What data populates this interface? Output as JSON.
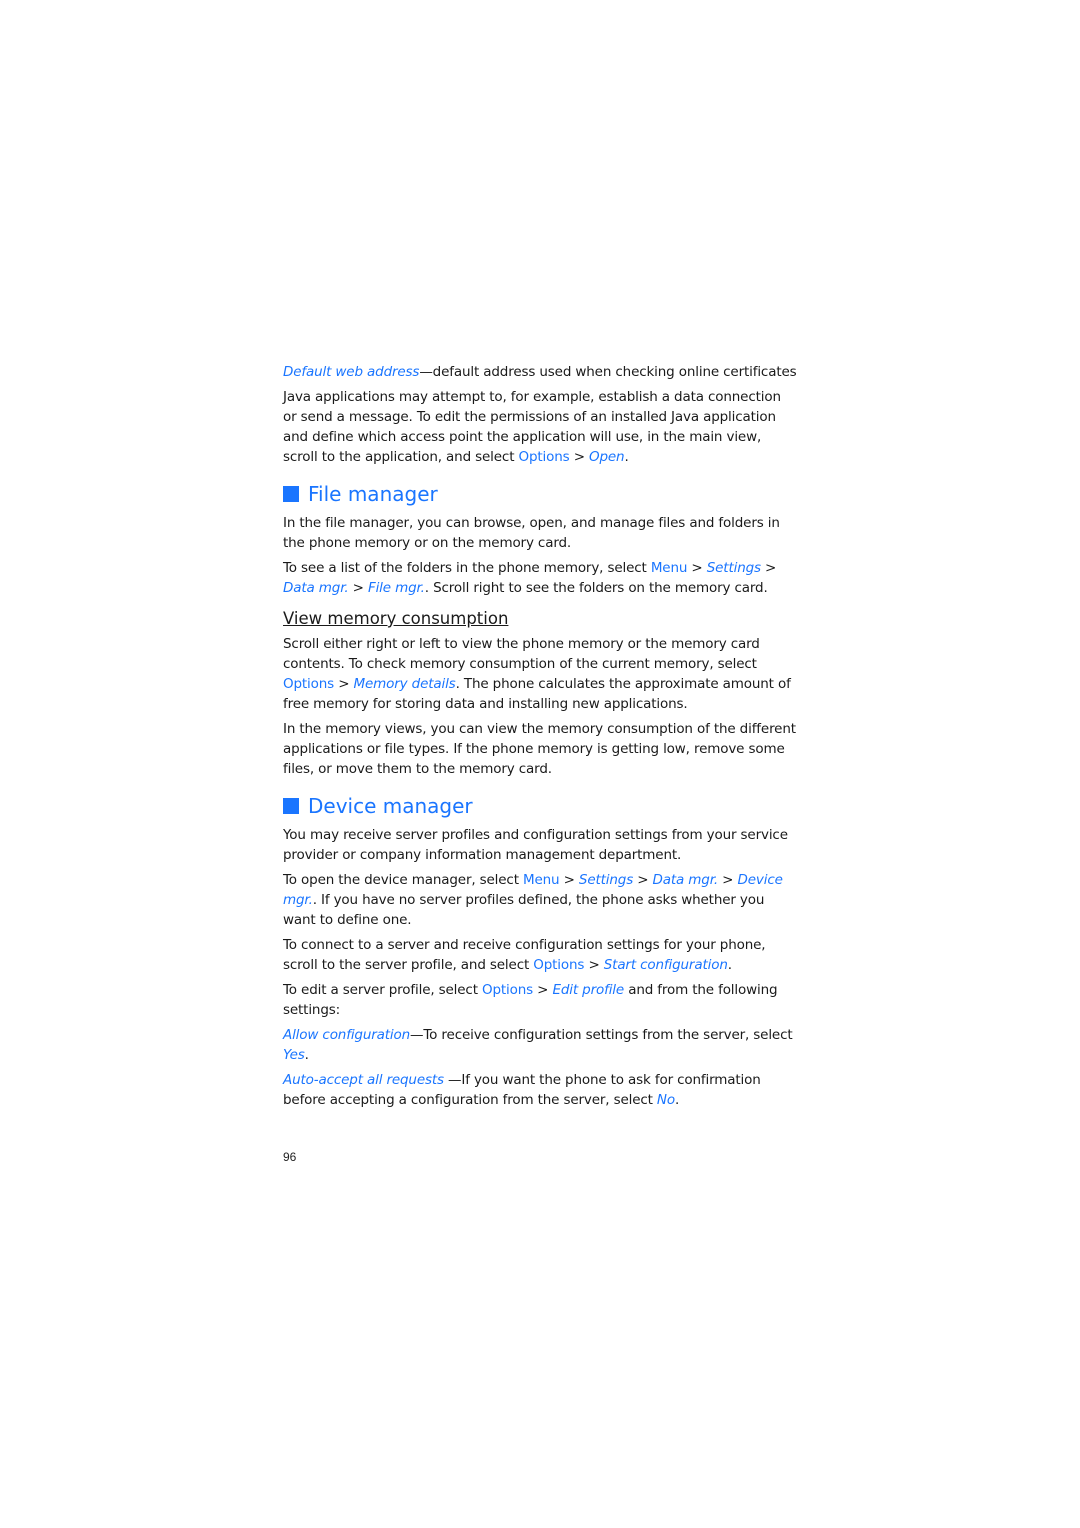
{
  "page_number": "96",
  "intro": {
    "default_web": {
      "term": "Default web address",
      "desc": "—default address used when checking online certificates"
    },
    "java_text": "Java applications may attempt to, for example, establish a data connection or send a message. To edit the permissions of an installed Java application and define which access point the application will use, in the main view, scroll to the application, and select ",
    "java_options": "Options",
    "java_sep": " > ",
    "java_open": "Open",
    "java_end": "."
  },
  "file_manager": {
    "heading": "File manager",
    "p1": "In the file manager, you can browse, open, and manage files and folders in the phone memory or on the memory card.",
    "p2_start": "To see a list of the folders in the phone memory, select ",
    "p2_menu": "Menu",
    "sep": " > ",
    "p2_settings": "Settings",
    "p2_data": "Data mgr.",
    "p2_file": "File mgr.",
    "p2_end": ". Scroll right to see the folders on the memory card.",
    "subheading": "View memory consumption",
    "p3_start": "Scroll either right or left to view the phone memory or the memory card contents. To check memory consumption of the current memory, select ",
    "p3_options": "Options",
    "p3_memory": "Memory details",
    "p3_end": ". The phone calculates the approximate amount of free memory for storing data and installing new applications.",
    "p4": "In the memory views, you can view the memory consumption of the different applications or file types. If the phone memory is getting low, remove some files, or move them to the memory card."
  },
  "device_manager": {
    "heading": "Device manager",
    "p1": "You may receive server profiles and configuration settings from your service provider or company information management department.",
    "p2_start": "To open the device manager, select ",
    "p2_menu": "Menu",
    "sep": " > ",
    "p2_settings": "Settings",
    "p2_data": "Data mgr.",
    "p2_device": "Device mgr.",
    "p2_end": ". If you have no server profiles defined, the phone asks whether you want to define one.",
    "p3_start": "To connect to a server and receive configuration settings for your phone, scroll to the server profile, and select ",
    "p3_options": "Options",
    "p3_start_config": "Start configuration",
    "p3_end": ".",
    "p4_start": "To edit a server profile, select ",
    "p4_options": "Options",
    "p4_edit": "Edit profile",
    "p4_end": " and from the following settings:",
    "allow_term": "Allow configuration",
    "allow_desc": "—To receive configuration settings from the server, select ",
    "allow_yes": "Yes",
    "allow_end": ".",
    "auto_term": "Auto-accept all requests",
    "auto_desc": " —If you want the phone to ask for confirmation before accepting a configuration from the server, select ",
    "auto_no": "No",
    "auto_end": "."
  }
}
